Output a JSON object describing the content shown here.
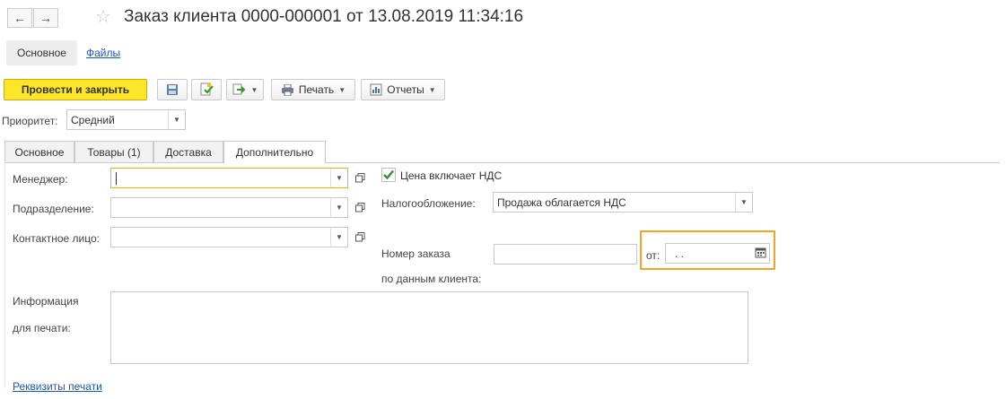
{
  "header": {
    "back_icon": "arrow-left-icon",
    "forward_icon": "arrow-right-icon",
    "favorite_icon": "star-icon",
    "title": "Заказ клиента 0000-000001 от 13.08.2019 11:34:16"
  },
  "form_tabs": {
    "main": "Основное",
    "files": "Файлы"
  },
  "toolbar": {
    "post_close": "Провести и закрыть",
    "print": "Печать",
    "reports": "Отчеты"
  },
  "priority": {
    "label": "Приоритет:",
    "value": "Средний"
  },
  "tabs": [
    "Основное",
    "Товары (1)",
    "Доставка",
    "Дополнительно"
  ],
  "fields": {
    "manager_label": "Менеджер:",
    "manager_value": "",
    "department_label": "Подразделение:",
    "department_value": "",
    "contact_label": "Контактное лицо:",
    "contact_value": "",
    "vat_checkbox_label": "Цена включает НДС",
    "vat_checked": true,
    "taxation_label": "Налогообложение:",
    "taxation_value": "Продажа облагается НДС",
    "order_number_label_1": "Номер заказа",
    "order_number_label_2": "по данным клиента:",
    "order_number_value": "",
    "from_label": "от:",
    "from_date_value": " .  .",
    "print_info_label_1": "Информация",
    "print_info_label_2": "для печати:",
    "print_info_value": ""
  },
  "footer": {
    "print_details_link": "Реквизиты печати"
  },
  "colors": {
    "primary": "#fde62a",
    "link": "#1c57b5",
    "focus": "#f0b400",
    "highlight": "#f0a526"
  }
}
